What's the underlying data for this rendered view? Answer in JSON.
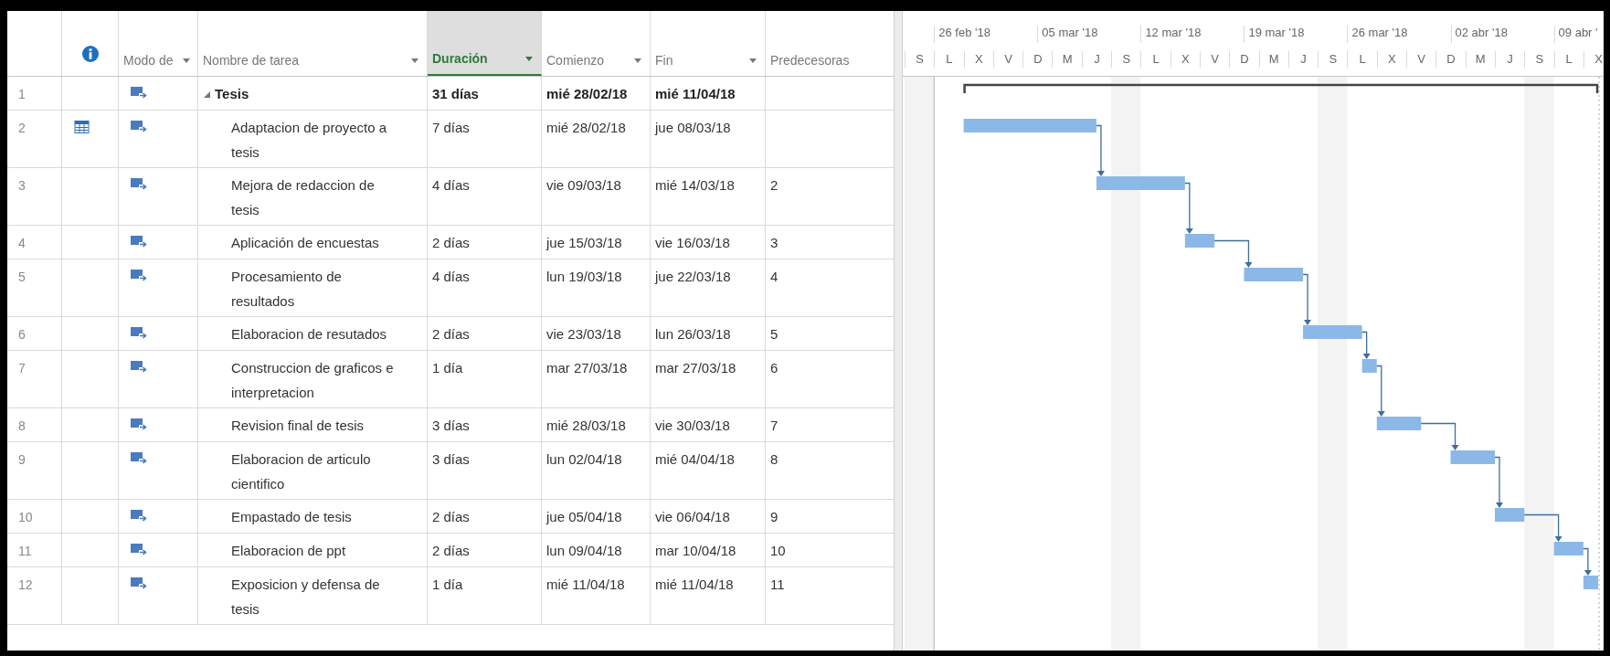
{
  "columns": [
    {
      "label": "Modo de",
      "filter": true,
      "selected": false
    },
    {
      "label": "Nombre de tarea",
      "filter": true,
      "selected": false
    },
    {
      "label": "Duración",
      "filter": true,
      "selected": true
    },
    {
      "label": "Comienzo",
      "filter": true,
      "selected": false
    },
    {
      "label": "Fin",
      "filter": true,
      "selected": false
    },
    {
      "label": "Predecesoras",
      "filter": false,
      "selected": false
    }
  ],
  "timescale": {
    "weeks": [
      "26 feb '18",
      "05 mar '18",
      "12 mar '18",
      "19 mar '18",
      "26 mar '18",
      "02 abr '18",
      "09 abr '"
    ],
    "days": [
      "S",
      "L",
      "X",
      "V",
      "D",
      "M",
      "J",
      "S",
      "L",
      "X",
      "V",
      "D",
      "M",
      "J",
      "S",
      "L",
      "X",
      "V",
      "D",
      "M",
      "J",
      "S",
      "L",
      "X"
    ]
  },
  "tasks": [
    {
      "id": "1",
      "name": "Tesis",
      "duration": "31 días",
      "start": "mié 28/02/18",
      "finish": "mié 11/04/18",
      "indicator": false,
      "expanded": true,
      "children": [
        {
          "id": "2",
          "name": "Adaptacion de proyecto a tesis",
          "duration": "7 días",
          "start": "mié 28/02/18",
          "finish": "jue 08/03/18",
          "indicator": true
        },
        {
          "id": "3",
          "name": "Mejora de redaccion de tesis",
          "duration": "4 días",
          "start": "vie 09/03/18",
          "finish": "mié 14/03/18",
          "predecessors": "2",
          "indicator": false
        },
        {
          "id": "4",
          "name": "Aplicación de encuestas",
          "duration": "2 días",
          "start": "jue 15/03/18",
          "finish": "vie 16/03/18",
          "predecessors": "3",
          "indicator": false
        },
        {
          "id": "5",
          "name": "Procesamiento de resultados",
          "duration": "4 días",
          "start": "lun 19/03/18",
          "finish": "jue 22/03/18",
          "predecessors": "4",
          "indicator": false
        },
        {
          "id": "6",
          "name": "Elaboracion de resutados",
          "duration": "2 días",
          "start": "vie 23/03/18",
          "finish": "lun 26/03/18",
          "predecessors": "5",
          "indicator": false
        },
        {
          "id": "7",
          "name": "Construccion de graficos e interpretacion",
          "duration": "1 día",
          "start": "mar 27/03/18",
          "finish": "mar 27/03/18",
          "predecessors": "6",
          "indicator": false
        },
        {
          "id": "8",
          "name": "Revision final de tesis",
          "duration": "3 días",
          "start": "mié 28/03/18",
          "finish": "vie 30/03/18",
          "predecessors": "7",
          "indicator": false
        },
        {
          "id": "9",
          "name": "Elaboracion de articulo cientifico",
          "duration": "3 días",
          "start": "lun 02/04/18",
          "finish": "mié 04/04/18",
          "predecessors": "8",
          "indicator": false
        },
        {
          "id": "10",
          "name": "Empastado de tesis",
          "duration": "2 días",
          "start": "jue 05/04/18",
          "finish": "vie 06/04/18",
          "predecessors": "9",
          "indicator": false
        },
        {
          "id": "11",
          "name": "Elaboracion de ppt",
          "duration": "2 días",
          "start": "lun 09/04/18",
          "finish": "mar 10/04/18",
          "predecessors": "10",
          "indicator": false
        },
        {
          "id": "12",
          "name": "Exposicion y defensa de tesis",
          "duration": "1 día",
          "start": "mié 11/04/18",
          "finish": "mié 11/04/18",
          "predecessors": "11",
          "indicator": false
        }
      ]
    }
  ]
}
